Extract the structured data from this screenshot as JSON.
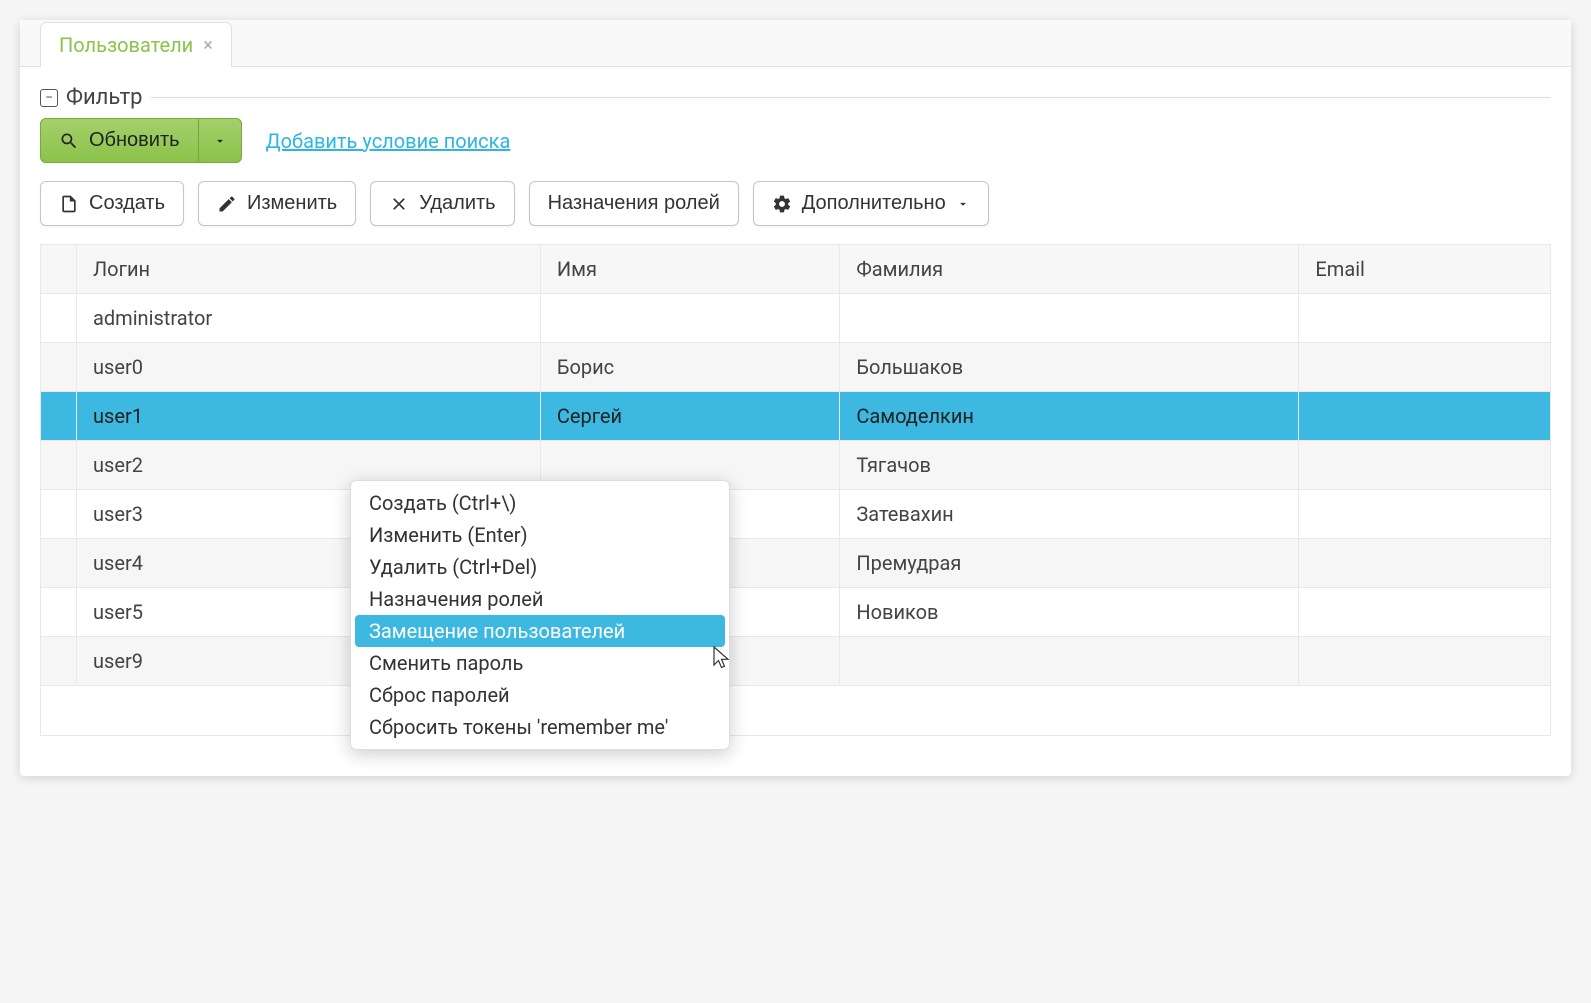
{
  "tab": {
    "label": "Пользователи"
  },
  "filter": {
    "legend": "Фильтр",
    "refresh_label": "Обновить",
    "add_condition_label": "Добавить условие поиска"
  },
  "toolbar": {
    "create_label": "Создать",
    "edit_label": "Изменить",
    "delete_label": "Удалить",
    "roles_label": "Назначения ролей",
    "more_label": "Дополнительно"
  },
  "table": {
    "headers": {
      "login": "Логин",
      "first_name": "Имя",
      "last_name": "Фамилия",
      "email": "Email"
    },
    "rows": [
      {
        "login": "administrator",
        "first_name": "",
        "last_name": "",
        "email": ""
      },
      {
        "login": "user0",
        "first_name": "Борис",
        "last_name": "Большаков",
        "email": ""
      },
      {
        "login": "user1",
        "first_name": "Сергей",
        "last_name": "Самоделкин",
        "email": "",
        "selected": true
      },
      {
        "login": "user2",
        "first_name": "",
        "last_name": "Тягачов",
        "email": ""
      },
      {
        "login": "user3",
        "first_name": "",
        "last_name": "Затевахин",
        "email": ""
      },
      {
        "login": "user4",
        "first_name": "",
        "last_name": "Премудрая",
        "email": ""
      },
      {
        "login": "user5",
        "first_name": "",
        "last_name": "Новиков",
        "email": ""
      },
      {
        "login": "user9",
        "first_name": "",
        "last_name": "",
        "email": ""
      }
    ]
  },
  "context_menu": {
    "items": [
      {
        "label": "Создать (Ctrl+\\)"
      },
      {
        "label": "Изменить (Enter)"
      },
      {
        "label": "Удалить (Ctrl+Del)"
      },
      {
        "label": "Назначения ролей"
      },
      {
        "label": "Замещение пользователей",
        "hover": true
      },
      {
        "label": "Сменить пароль"
      },
      {
        "label": "Сброс паролей"
      },
      {
        "label": "Сбросить токены 'remember me'"
      }
    ]
  }
}
